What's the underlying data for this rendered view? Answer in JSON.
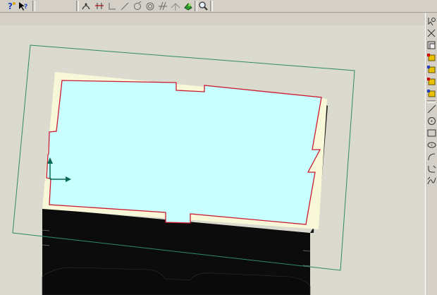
{
  "toolbar": {
    "left_tools": [
      "help-icon",
      "context-help-icon"
    ],
    "sketch_tools": [
      "sketcher-icon",
      "dimension-icon",
      "reference-icon",
      "line-icon",
      "circle-icon",
      "concentric-circle-icon",
      "constraint-icon",
      "spline-icon",
      "point-icon",
      "sketch-done-icon",
      "zoom-icon"
    ]
  },
  "right_toolbar": {
    "tools": [
      "sketch-select-icon",
      "sketch-view-icon",
      "sketch-grid-icon",
      "sketch-yellow-a-icon",
      "sketch-yellow-b-icon",
      "sketch-yellow-c-icon",
      "sketch-yellow-d-icon",
      "line-tool-icon",
      "circle-tool-icon",
      "rectangle-tool-icon",
      "ellipse-tool-icon",
      "arc-tool-icon",
      "fillet-tool-icon",
      "spline-tool-icon"
    ]
  },
  "colors": {
    "viewport_bg": "#dadace",
    "sketch_plane": "#2e8b6a",
    "sketch_face": "#c8ffff",
    "sketch_edges": "#cc1a33",
    "part_top": "#f8f8d8",
    "part_dark": "#0c0c0c",
    "axis": "#0a6a52"
  }
}
